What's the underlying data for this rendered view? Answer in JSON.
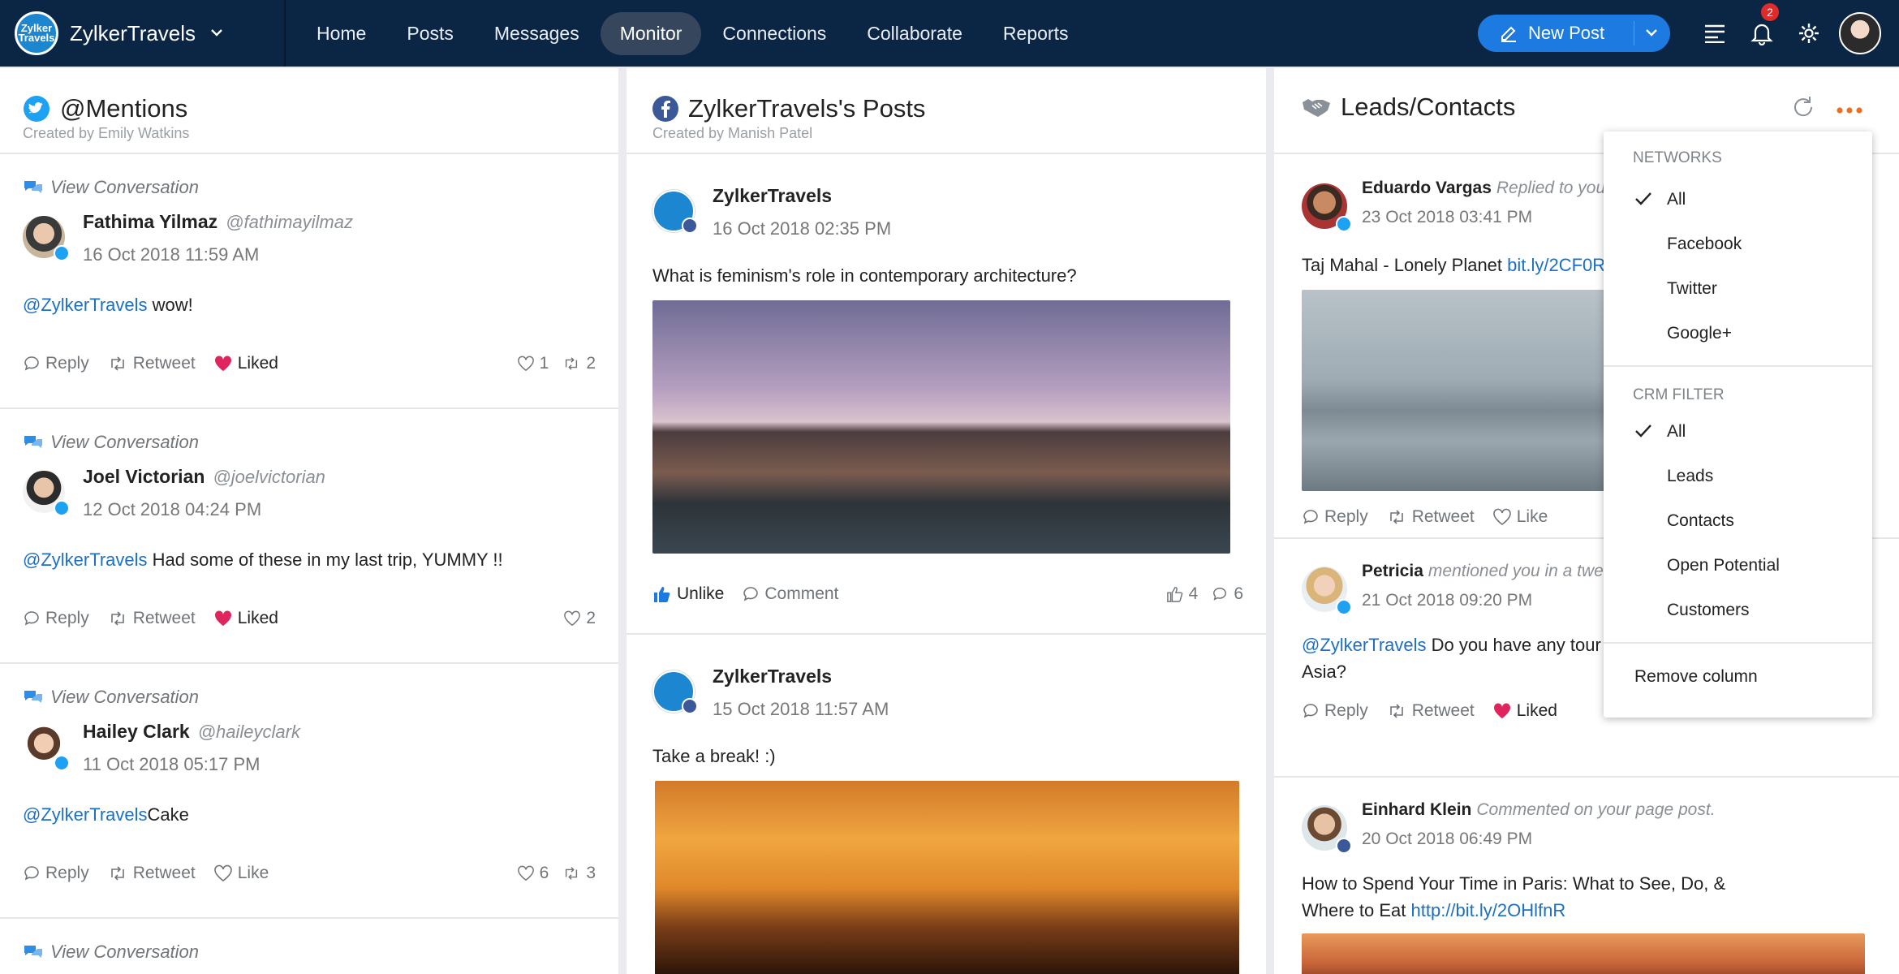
{
  "topbar": {
    "brand_name": "ZylkerTravels",
    "logo_text": "Zylker Travels",
    "nav": [
      "Home",
      "Posts",
      "Messages",
      "Monitor",
      "Connections",
      "Collaborate",
      "Reports"
    ],
    "active_nav": "Monitor",
    "new_post_label": "New Post",
    "notification_count": "2"
  },
  "col1": {
    "title": "@Mentions",
    "subtitle": "Created by Emily Watkins",
    "cards": [
      {
        "view": "View Conversation",
        "name": "Fathima Yilmaz",
        "handle": "@fathimayilmaz",
        "time": "16 Oct 2018 11:59 AM",
        "mention": "@ZylkerTravels",
        "text": " wow!",
        "reply": "Reply",
        "retweet": "Retweet",
        "like": "Liked",
        "likes": "1",
        "retweets": "2"
      },
      {
        "view": "View Conversation",
        "name": "Joel Victorian",
        "handle": "@joelvictorian",
        "time": "12 Oct 2018 04:24 PM",
        "mention": "@ZylkerTravels",
        "text": " Had some of these in my last trip, YUMMY !!",
        "reply": "Reply",
        "retweet": "Retweet",
        "like": "Liked",
        "likes": "2"
      },
      {
        "view": "View Conversation",
        "name": "Hailey Clark",
        "handle": "@haileyclark",
        "time": "11 Oct 2018 05:17 PM",
        "mention": "@ZylkerTravels",
        "text": "Cake",
        "reply": "Reply",
        "retweet": "Retweet",
        "like": "Like",
        "likes": "6",
        "retweets": "3"
      },
      {
        "view": "View Conversation"
      }
    ]
  },
  "col2": {
    "title": "ZylkerTravels's Posts",
    "subtitle": "Created by Manish Patel",
    "posts": [
      {
        "name": "ZylkerTravels",
        "time": "16 Oct 2018 02:35 PM",
        "text": "What is feminism's role in contemporary architecture?",
        "unlike": "Unlike",
        "comment": "Comment",
        "likes": "4",
        "comments": "6"
      },
      {
        "name": "ZylkerTravels",
        "time": "15 Oct 2018 11:57 AM",
        "text": "Take a break! :)"
      }
    ]
  },
  "col3": {
    "title": "Leads/Contacts",
    "cards": [
      {
        "name": "Eduardo Vargas",
        "activity": "Replied to you",
        "time": "23 Oct 2018 03:41 PM",
        "text": "Taj Mahal - Lonely Planet ",
        "link": "bit.ly/2CF0R",
        "reply": "Reply",
        "retweet": "Retweet",
        "like": "Like"
      },
      {
        "name": "Petricia",
        "activity": "mentioned you in a tweet",
        "time": "21 Oct 2018 09:20 PM",
        "mention": "@ZylkerTravels",
        "text": " Do you have any tour",
        "text2": "Asia?",
        "reply": "Reply",
        "retweet": "Retweet",
        "like": "Liked"
      },
      {
        "name": "Einhard Klein",
        "activity": "Commented on your page post.",
        "time": "20 Oct 2018 06:49 PM",
        "text": "How to Spend Your Time in Paris: What to See, Do, &",
        "text2": "Where to Eat ",
        "link": "http://bit.ly/2OHlfnR"
      }
    ]
  },
  "dropdown": {
    "networks_header": "NETWORKS",
    "networks": [
      "All",
      "Facebook",
      "Twitter",
      "Google+"
    ],
    "crm_header": "CRM FILTER",
    "crm": [
      "All",
      "Leads",
      "Contacts",
      "Open Potential",
      "Customers"
    ],
    "remove": "Remove column"
  },
  "colors": {
    "topbar": "#0b2545",
    "accent": "#1d7ae0",
    "liked": "#e0245e",
    "twitter": "#1da1f2",
    "facebook": "#1877f2",
    "more": "#e8712a"
  }
}
